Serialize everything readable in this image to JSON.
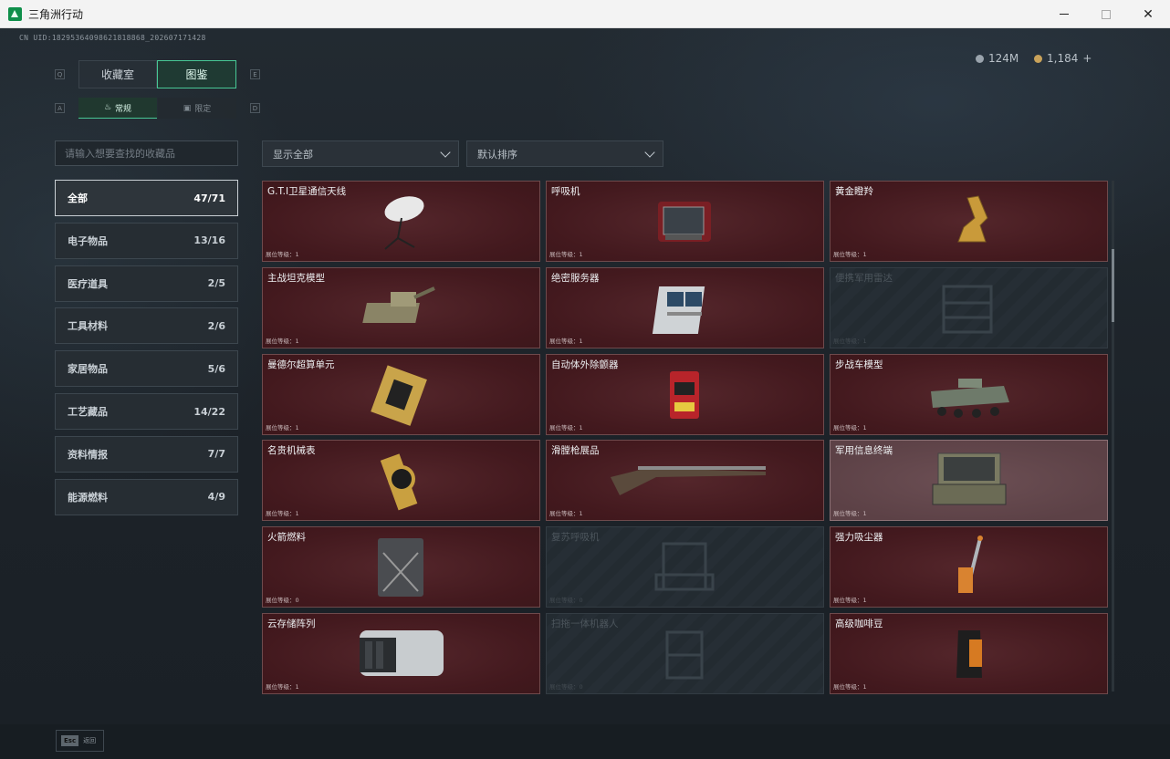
{
  "window": {
    "title": "三角洲行动",
    "minimize": "",
    "maximize": "",
    "close": "✕"
  },
  "header": {
    "uid": "CN UID:18295364098621818868_202607171428",
    "currency_a": "124M",
    "currency_b": "1,184",
    "add": "+"
  },
  "tabs": {
    "key_left": "Q",
    "key_right": "E",
    "items": [
      {
        "label": "收藏室"
      },
      {
        "label": "图鉴"
      }
    ],
    "active_index": 1
  },
  "subtabs": {
    "key_left": "A",
    "key_right": "D",
    "items": [
      {
        "label": "常规"
      },
      {
        "label": "限定"
      }
    ]
  },
  "search": {
    "placeholder": "请输入想要查找的收藏品"
  },
  "filters": {
    "filter_value": "显示全部",
    "sort_value": "默认排序"
  },
  "categories": [
    {
      "label": "全部",
      "count": "47/71"
    },
    {
      "label": "电子物品",
      "count": "13/16"
    },
    {
      "label": "医疗道具",
      "count": "2/5"
    },
    {
      "label": "工具材料",
      "count": "2/6"
    },
    {
      "label": "家居物品",
      "count": "5/6"
    },
    {
      "label": "工艺藏品",
      "count": "14/22"
    },
    {
      "label": "资料情报",
      "count": "7/7"
    },
    {
      "label": "能源燃料",
      "count": "4/9"
    }
  ],
  "items": [
    {
      "name": "G.T.I卫星通信天线",
      "level": "展位等级：1",
      "locked": false,
      "icon": "satellite-dish-icon"
    },
    {
      "name": "呼吸机",
      "level": "展位等级：1",
      "locked": false,
      "icon": "ventilator-icon"
    },
    {
      "name": "黄金瞪羚",
      "level": "展位等级：1",
      "locked": false,
      "icon": "gold-gazelle-icon"
    },
    {
      "name": "主战坦克模型",
      "level": "展位等级：1",
      "locked": false,
      "icon": "tank-model-icon"
    },
    {
      "name": "绝密服务器",
      "level": "展位等级：1",
      "locked": false,
      "icon": "server-icon"
    },
    {
      "name": "便携军用雷达",
      "level": "展位等级：1",
      "locked": true,
      "icon": "radar-icon"
    },
    {
      "name": "曼德尔超算单元",
      "level": "展位等级：1",
      "locked": false,
      "icon": "cpu-unit-icon"
    },
    {
      "name": "自动体外除颤器",
      "level": "展位等级：1",
      "locked": false,
      "icon": "defibrillator-icon"
    },
    {
      "name": "步战车模型",
      "level": "展位等级：1",
      "locked": false,
      "icon": "ifv-model-icon"
    },
    {
      "name": "名贵机械表",
      "level": "展位等级：1",
      "locked": false,
      "icon": "watch-icon"
    },
    {
      "name": "滑膛枪展品",
      "level": "展位等级：1",
      "locked": false,
      "icon": "musket-icon"
    },
    {
      "name": "军用信息终端",
      "level": "展位等级：1",
      "locked": false,
      "hover": true,
      "icon": "terminal-icon"
    },
    {
      "name": "火箭燃料",
      "level": "展位等级：0",
      "locked": false,
      "icon": "fuel-can-icon"
    },
    {
      "name": "复苏呼吸机",
      "level": "展位等级：0",
      "locked": true,
      "icon": "resuscitator-icon"
    },
    {
      "name": "强力吸尘器",
      "level": "展位等级：1",
      "locked": false,
      "icon": "vacuum-icon"
    },
    {
      "name": "云存储阵列",
      "level": "展位等级：1",
      "locked": false,
      "icon": "storage-array-icon"
    },
    {
      "name": "扫拖一体机器人",
      "level": "展位等级：0",
      "locked": true,
      "icon": "robot-vacuum-icon"
    },
    {
      "name": "高级咖啡豆",
      "level": "展位等级：1",
      "locked": false,
      "icon": "coffee-bag-icon"
    }
  ],
  "footer": {
    "esc_key": "Esc",
    "esc_label": "返回"
  }
}
